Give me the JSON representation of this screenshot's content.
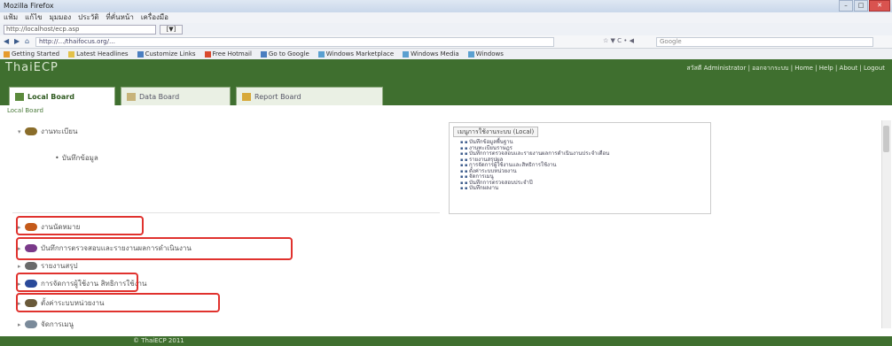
{
  "window": {
    "title": "Mozilla Firefox",
    "controls": [
      "–",
      "□",
      "✕"
    ]
  },
  "browser": {
    "menus": [
      "แฟ้ม",
      "แก้ไข",
      "มุมมอง",
      "ประวัติ",
      "ที่คั่นหน้า",
      "เครื่องมือ"
    ],
    "url_field": "http://localhost/ecp.asp",
    "url_go": "[▼]",
    "address": "http://…/thaifocus.org/…",
    "address_tools": "☆ ▼ C  •  ◀",
    "search_placeholder": "Google",
    "favorites": [
      {
        "label": "Getting Started",
        "color": "#e69a2e"
      },
      {
        "label": "Latest Headlines",
        "color": "#e3c14a"
      },
      {
        "label": "Customize Links",
        "color": "#4a7ec0"
      },
      {
        "label": "Free Hotmail",
        "color": "#d94a2e"
      },
      {
        "label": "Go to Google",
        "color": "#4a7ec0"
      },
      {
        "label": "Windows Marketplace",
        "color": "#5aa0d0"
      },
      {
        "label": "Windows Media",
        "color": "#5aa0d0"
      },
      {
        "label": "Windows",
        "color": "#5aa0d0"
      }
    ]
  },
  "app": {
    "brand": "ThaiECP",
    "top_links": "สวัสดี Administrator | ออกจากระบบ | Home | Help | About | Logout",
    "tabs": [
      {
        "label": "Local Board",
        "active": true,
        "icon_color": "#5b8a3c"
      },
      {
        "label": "Data Board",
        "active": false,
        "icon_color": "#c7b37a"
      },
      {
        "label": "Report Board",
        "active": false,
        "icon_color": "#d7a93a"
      }
    ],
    "subtitle": "Local Board",
    "footer": "© ThaiECP 2011"
  },
  "tree": {
    "nodes": [
      {
        "label": "งานทะเบียน",
        "toggle": "▾",
        "icon_color": "#8a6d2a",
        "highlight": false
      },
      {
        "label": "บันทึกข้อมูล",
        "child": true
      },
      {
        "label": "งานนัดหมาย",
        "toggle": "▸",
        "icon_color": "#c45a1a",
        "highlight": true
      },
      {
        "label": "บันทึกการตรวจสอบและรายงานผลการดำเนินงาน",
        "toggle": "▸",
        "icon_color": "#7a3a8a",
        "highlight": true
      },
      {
        "label": "รายงานสรุป",
        "toggle": "▸",
        "icon_color": "#6a6a6a",
        "highlight": false
      },
      {
        "label": "การจัดการผู้ใช้งาน",
        "label2": "สิทธิการใช้งาน",
        "toggle": "▸",
        "icon_color": "#2a4a9a",
        "highlight": true
      },
      {
        "label": "ตั้งค่าระบบหน่วยงาน",
        "toggle": "▸",
        "icon_color": "#6a5a3a",
        "highlight": true
      },
      {
        "label": "จัดการเมนู",
        "toggle": "▸",
        "icon_color": "#7a8a9a",
        "highlight": false
      }
    ]
  },
  "menu_box": {
    "title": "เมนูการใช้งานระบบ (Local)",
    "items": [
      "บันทึกข้อมูลพื้นฐาน",
      "งานทะเบียนราษฎร",
      "บันทึกการตรวจสอบและรายงานผลการดำเนินงานประจำเดือน",
      "รายงานสรุปผล",
      "การจัดการผู้ใช้งานและสิทธิการใช้งาน",
      "ตั้งค่าระบบหน่วยงาน",
      "จัดการเมนู",
      "บันทึกการตรวจสอบประจำปี",
      "บันทึกผลงาน"
    ]
  }
}
